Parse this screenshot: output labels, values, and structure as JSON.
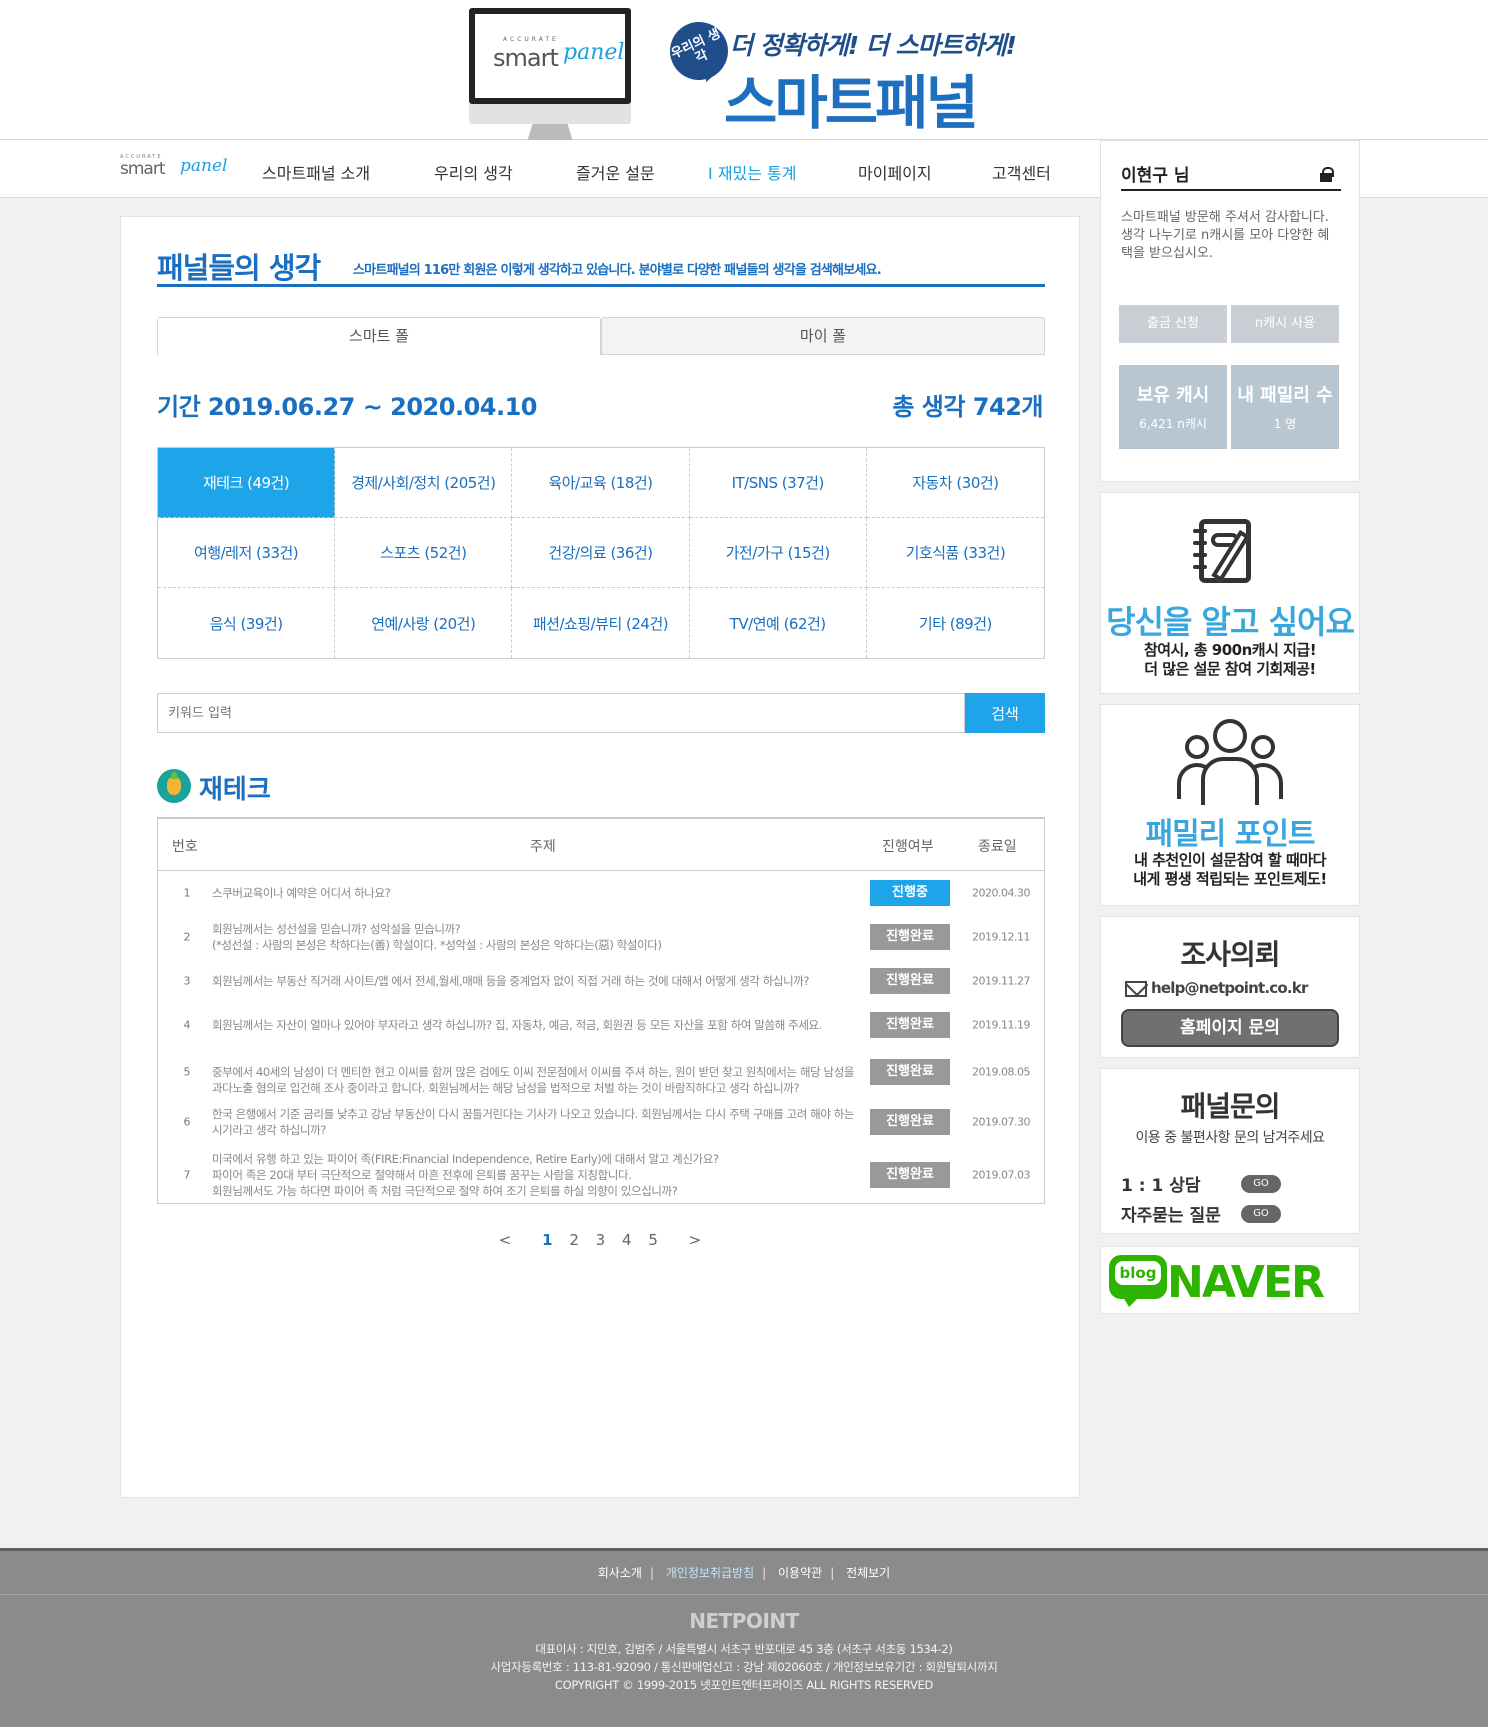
{
  "header": {
    "monitor_logo_sup": "ACCURATE",
    "monitor_logo_main": "smart",
    "monitor_logo_script": "panel",
    "badge": "우리의 생각",
    "slogan": "더 정확하게! 더 스마트하게!",
    "brand": "스마트패널"
  },
  "nav": {
    "logo_sup": "ACCURATE",
    "logo_main": "smart",
    "logo_script": "panel",
    "items": [
      "스마트패널 소개",
      "우리의 생각",
      "즐거운 설문",
      "재밌는 통계",
      "마이페이지",
      "고객센터"
    ],
    "active": "재밌는 통계"
  },
  "main": {
    "title": "패널들의 생각",
    "subtitle": "스마트패널의 116만 회원은 이렇게 생각하고 있습니다. 분야별로 다양한 패널들의 생각을 검색해보세요.",
    "tabs": [
      "스마트 폴",
      "마이 폴"
    ],
    "period": "기간 2019.06.27 ~ 2020.04.10",
    "total": "총 생각 742개",
    "categories": [
      "재테크 (49건)",
      "경제/사회/정치 (205건)",
      "육아/교육 (18건)",
      "IT/SNS (37건)",
      "자동차 (30건)",
      "여행/레저 (33건)",
      "스포츠 (52건)",
      "건강/의료 (36건)",
      "가전/가구 (15건)",
      "기호식품 (33건)",
      "음식 (39건)",
      "연예/사랑 (20건)",
      "패션/쇼핑/뷰티 (24건)",
      "TV/연예 (62건)",
      "기타 (89건)"
    ],
    "active_category": "재테크 (49건)",
    "search": {
      "placeholder": "키워드 입력",
      "button": "검색"
    },
    "section_title": "재테크",
    "table": {
      "headers": [
        "번호",
        "주제",
        "진행여부",
        "종료일"
      ],
      "rows": [
        {
          "no": "1",
          "subject": "스쿠버교육이나 예약은 어디서 하나요?",
          "status": "진행중",
          "date": "2020.04.30"
        },
        {
          "no": "2",
          "subject": "회원님께서는 성선설을 믿습니까? 성악설을 믿습니까?\n(*성선설 : 사람의 본성은 착하다는(善) 학설이다. *성악설 : 사람의 본성은 악하다는(惡) 학설이다)",
          "status": "진행완료",
          "date": "2019.12.11"
        },
        {
          "no": "3",
          "subject": "회원님께서는 부동산 직거래 사이트/앱 에서 전세,월세,매매 등을 중계업자 없이 직접 거래 하는 것에 대해서 어떻게 생각 하십니까?",
          "status": "진행완료",
          "date": "2019.11.27"
        },
        {
          "no": "4",
          "subject": "회원님께서는 자산이 얼마나 있어야 부자라고 생각 하십니까? 집, 자동차, 예금, 적금, 회원권 등 모든 자산을 포함 하여 말씀해 주세요.",
          "status": "진행완료",
          "date": "2019.11.19"
        },
        {
          "no": "5",
          "subject": "중부에서 40세의 남성이 더 멘티한 현고 이씨를 함꺼 많은 검에도 이씨 전문점에서 이씨를 주셔 하는, 원이 받던 찾고 원칙에서는 해당 남성을 과다노출 혐의로 입건해 조사 중이라고 합니다. 회원님께서는 해당 남성을 법적으로 처벌 하는 것이 바람직하다고 생각 하십니까?",
          "status": "진행완료",
          "date": "2019.08.05"
        },
        {
          "no": "6",
          "subject": "한국 은행에서 기준 금리를 낮추고 강남 부동산이 다시 꿈틀거린다는 기사가 나오고 있습니다. 회원님께서는 다시 주택 구매를 고려 해야 하는 시기라고 생각 하십니까?",
          "status": "진행완료",
          "date": "2019.07.30"
        },
        {
          "no": "7",
          "subject": "미국에서 유행 하고 있는 파이어 족(FIRE:Financial Independence, Retire Early)에 대해서 알고 계신가요?\n파이어 족은 20대 부터 극단적으로 절약해서 마흔 전후에 은퇴를 꿈꾸는 사람을 지칭합니다.\n회원님께서도 가능 하다면 파이어 족 처럼 극단적으로 절약 하여 조기 은퇴를 하실 의향이 있으십니까?",
          "status": "진행완료",
          "date": "2019.07.03"
        }
      ]
    },
    "pagination": {
      "prev": "<",
      "pages": [
        "1",
        "2",
        "3",
        "4",
        "5"
      ],
      "current": "1",
      "next": ">"
    }
  },
  "sidebar": {
    "user_name": "이현구 님",
    "welcome": "스마트패널 방문해 주셔서 감사합니다.\n생각 나누기로 n캐시를 모아 다양한 혜택을 받으십시오.",
    "buttons": [
      "출금 신청",
      "n캐시 사용"
    ],
    "stats": [
      {
        "label": "보유 캐시",
        "value": "6,421 n캐시"
      },
      {
        "label": "내 패밀리 수",
        "value": "1 명"
      }
    ],
    "know": {
      "title": "당신을 알고 싶어요",
      "desc1": "참여시, 총 900n캐시 지급!",
      "desc2": "더 많은 설문 참여 기회제공!"
    },
    "family": {
      "title": "패밀리 포인트",
      "desc1": "내 추천인이 설문참여 할 때마다",
      "desc2": "내게 평생 적립되는 포인트제도!"
    },
    "survey": {
      "title": "조사의뢰",
      "email": "help@netpoint.co.kr",
      "button": "홈페이지 문의"
    },
    "panelq": {
      "title": "패널문의",
      "desc": "이용 중 불편사항 문의 남겨주세요",
      "q1": "1 : 1 상담",
      "q2": "자주묻는 질문",
      "go": "GO"
    },
    "naver": {
      "blog": "blog",
      "naver": "NAVER"
    }
  },
  "footer": {
    "links": [
      "회사소개",
      "개인정보취급방침",
      "이용약관",
      "전체보기"
    ],
    "logo": "NETPOINT",
    "line1": "대표이사 : 지민호, 김범주 / 서울특별시 서초구 반포대로 45 3층 (서초구 서초동 1534-2)",
    "line2": "사업자등록번호 : 113-81-92090 / 통신판매업신고 : 강남 제02060호 / 개인정보보유기간 : 회원탈퇴시까지",
    "line3": "COPYRIGHT © 1999-2015 넷포인트엔터프라이즈 ALL RIGHTS RESERVED"
  },
  "colors": {
    "brand_blue": "#1a6fc0",
    "accent_blue": "#1ea5e9",
    "sky": "#3aa6de",
    "naver_green": "#2db400",
    "done_grey": "#999999"
  }
}
